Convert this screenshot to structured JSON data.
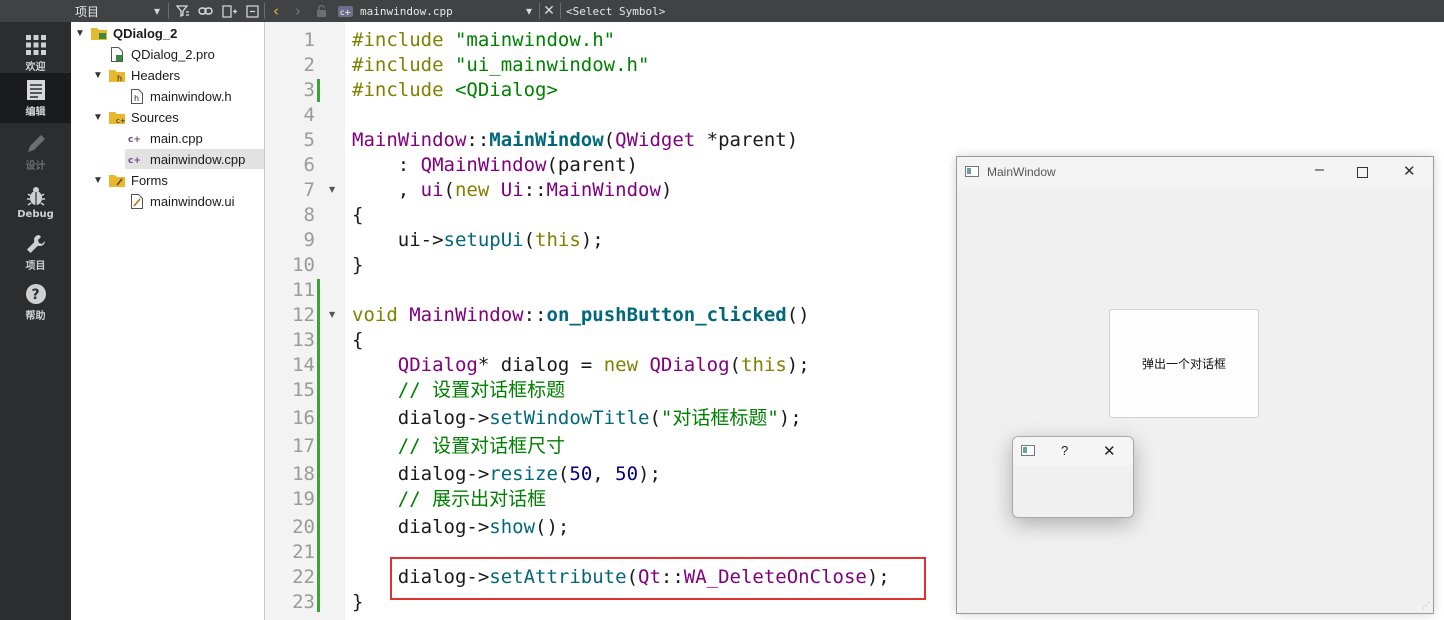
{
  "toolbar": {
    "panel_title": "项目",
    "file_name": "mainwindow.cpp",
    "symbol": "<Select Symbol>"
  },
  "modes": [
    {
      "label": "欢迎",
      "icon": "grid-icon"
    },
    {
      "label": "编辑",
      "icon": "edit-icon"
    },
    {
      "label": "设计",
      "icon": "pencil-icon"
    },
    {
      "label": "Debug",
      "icon": "bug-icon"
    },
    {
      "label": "项目",
      "icon": "wrench-icon"
    },
    {
      "label": "帮助",
      "icon": "help-icon"
    }
  ],
  "tree": {
    "project": "QDialog_2",
    "pro_file": "QDialog_2.pro",
    "headers": "Headers",
    "header_file": "mainwindow.h",
    "sources": "Sources",
    "source_main": "main.cpp",
    "source_window": "mainwindow.cpp",
    "forms": "Forms",
    "form_file": "mainwindow.ui"
  },
  "lines": [
    "1",
    "2",
    "3",
    "4",
    "5",
    "6",
    "7",
    "8",
    "9",
    "10",
    "11",
    "12",
    "13",
    "14",
    "15",
    "16",
    "17",
    "18",
    "19",
    "20",
    "21",
    "22",
    "23"
  ],
  "code": {
    "l1a": "#include ",
    "l1b": "\"mainwindow.h\"",
    "l2a": "#include ",
    "l2b": "\"ui_mainwindow.h\"",
    "l3a": "#include ",
    "l3b": "<QDialog>",
    "l5a": "MainWindow",
    "l5b": "::",
    "l5c": "MainWindow",
    "l5d": "(",
    "l5e": "QWidget",
    "l5f": " *parent)",
    "l6a": "    : ",
    "l6b": "QMainWindow",
    "l6c": "(parent)",
    "l7a": "    , ",
    "l7b": "ui",
    "l7c": "(",
    "l7d": "new",
    "l7e": " ",
    "l7f": "Ui",
    "l7g": "::",
    "l7h": "MainWindow",
    "l7i": ")",
    "l8": "{",
    "l9a": "    ui->",
    "l9b": "setupUi",
    "l9c": "(",
    "l9d": "this",
    "l9e": ");",
    "l10": "}",
    "l12a": "void",
    "l12b": " ",
    "l12c": "MainWindow",
    "l12d": "::",
    "l12e": "on_pushButton_clicked",
    "l12f": "()",
    "l13": "{",
    "l14a": "    ",
    "l14b": "QDialog",
    "l14c": "* dialog = ",
    "l14d": "new",
    "l14e": " ",
    "l14f": "QDialog",
    "l14g": "(",
    "l14h": "this",
    "l14i": ");",
    "l15": "    // 设置对话框标题",
    "l16a": "    dialog->",
    "l16b": "setWindowTitle",
    "l16c": "(",
    "l16d": "\"对话框标题\"",
    "l16e": ");",
    "l17": "    // 设置对话框尺寸",
    "l18a": "    dialog->",
    "l18b": "resize",
    "l18c": "(",
    "l18d": "50",
    "l18e": ", ",
    "l18f": "50",
    "l18g": ");",
    "l19": "    // 展示出对话框",
    "l20a": "    dialog->",
    "l20b": "show",
    "l20c": "();",
    "l22a": "    dialog->",
    "l22b": "setAttribute",
    "l22c": "(",
    "l22d": "Qt",
    "l22e": "::",
    "l22f": "WA_DeleteOnClose",
    "l22g": ");",
    "l23": "}"
  },
  "main_window": {
    "title": "MainWindow",
    "button_label": "弹出一个对话框"
  },
  "dialog": {
    "help": "?"
  }
}
